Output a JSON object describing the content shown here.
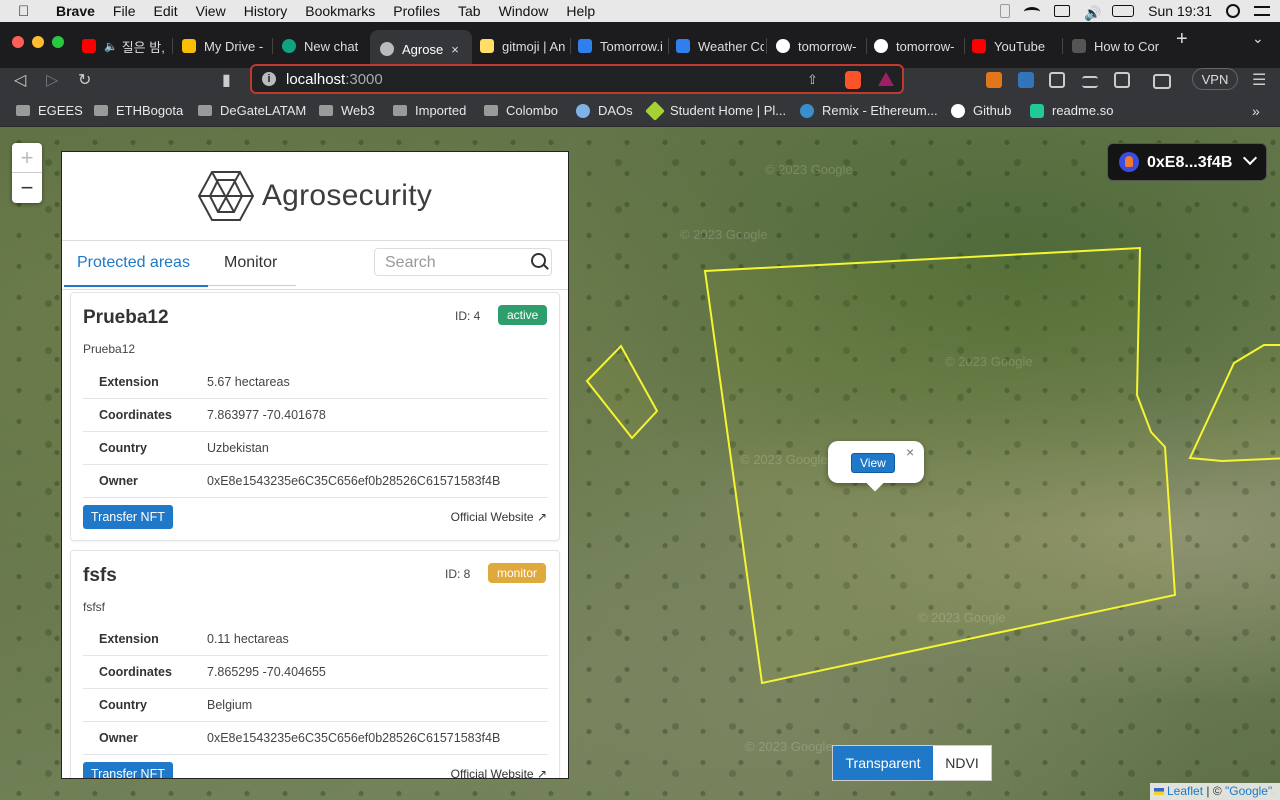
{
  "menubar": {
    "app": "Brave",
    "items": [
      "File",
      "Edit",
      "View",
      "History",
      "Bookmarks",
      "Profiles",
      "Tab",
      "Window",
      "Help"
    ],
    "clock": "Sun 19:31"
  },
  "tabs": [
    {
      "label": "질은 밤,",
      "color": "#ff0000"
    },
    {
      "label": "My Drive -",
      "color": "#fbbc04"
    },
    {
      "label": "New chat",
      "color": "#10a37f"
    },
    {
      "label": "Agrose",
      "color": "#cccccc"
    },
    {
      "label": "gitmoji | An",
      "color": "#ffdd67"
    },
    {
      "label": "Tomorrow.i",
      "color": "#2f80ed"
    },
    {
      "label": "Weather Co",
      "color": "#2f80ed"
    },
    {
      "label": "tomorrow-",
      "color": "#ffffff"
    },
    {
      "label": "tomorrow-",
      "color": "#ffffff"
    },
    {
      "label": "YouTube",
      "color": "#ff0000"
    },
    {
      "label": "How to Cor",
      "color": "#555555"
    }
  ],
  "url": {
    "host": "localhost",
    "port": ":3000"
  },
  "vpn": "VPN",
  "bookmarks": [
    {
      "label": "EGEES",
      "kind": "folder"
    },
    {
      "label": "ETHBogota",
      "kind": "folder"
    },
    {
      "label": "DeGateLATAM",
      "kind": "folder"
    },
    {
      "label": "Web3",
      "kind": "folder"
    },
    {
      "label": "Imported",
      "kind": "folder"
    },
    {
      "label": "Colombo",
      "kind": "folder"
    },
    {
      "label": "DAOs",
      "kind": "site",
      "color": "#7fb3e8"
    },
    {
      "label": "Student Home | Pl...",
      "kind": "site",
      "color": "#a4d233"
    },
    {
      "label": "Remix - Ethereum...",
      "kind": "site",
      "color": "#3a8ecc"
    },
    {
      "label": "Github",
      "kind": "site",
      "color": "#ffffff"
    },
    {
      "label": "readme.so",
      "kind": "site",
      "color": "#20c997"
    }
  ],
  "zoom": {
    "in": "+",
    "out": "−"
  },
  "panel": {
    "brand": "Agrosecurity",
    "tabs": {
      "protected": "Protected areas",
      "monitor": "Monitor"
    },
    "search_placeholder": "Search",
    "cards": [
      {
        "name": "Prueba12",
        "id": "ID: 4",
        "status": "active",
        "status_color": "#2e9f6c",
        "description": "Prueba12",
        "labels": {
          "extension": "Extension",
          "coordinates": "Coordinates",
          "country": "Country",
          "owner": "Owner"
        },
        "extension": "5.67 hectareas",
        "coordinates": "7.863977 -70.401678",
        "country": "Uzbekistan",
        "owner": "0xE8e1543235e6C35C656ef0b28526C61571583f4B",
        "transfer": "Transfer NFT",
        "website": "Official Website"
      },
      {
        "name": "fsfs",
        "id": "ID: 8",
        "status": "monitor",
        "status_color": "#e0a93c",
        "description": "fsfsf",
        "labels": {
          "extension": "Extension",
          "coordinates": "Coordinates",
          "country": "Country",
          "owner": "Owner"
        },
        "extension": "0.11 hectareas",
        "coordinates": "7.865295 -70.404655",
        "country": "Belgium",
        "owner": "0xE8e1543235e6C35C656ef0b28526C61571583f4B",
        "transfer": "Transfer NFT",
        "website": "Official Website"
      }
    ]
  },
  "wallet": {
    "address": "0xE8...3f4B"
  },
  "popup": {
    "view": "View",
    "close": "×"
  },
  "layers": {
    "transparent": "Transparent",
    "ndvi": "NDVI"
  },
  "attribution": {
    "leaflet": "Leaflet",
    "sep": " | © ",
    "google": "\"Google\""
  },
  "watermark": "© 2023 Google",
  "polygon_color": "#f5f531"
}
